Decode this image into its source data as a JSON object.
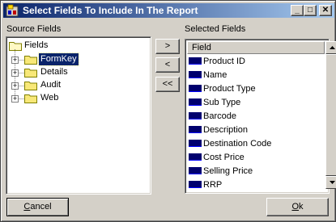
{
  "window": {
    "title": "Select Fields To Include In The Report",
    "minimize_glyph": "_",
    "maximize_glyph": "□",
    "close_glyph": "✕"
  },
  "source": {
    "label": "Source Fields",
    "root": "Fields",
    "expander_glyph": "+",
    "nodes": [
      "FormKey",
      "Details",
      "Audit",
      "Web"
    ]
  },
  "transfer": {
    "add_glyph": ">",
    "remove_glyph": "<",
    "remove_all_glyph": "<<"
  },
  "selected": {
    "label": "Selected Fields",
    "column_header": "Field",
    "items": [
      "Product ID",
      "Name",
      "Product Type",
      "Sub Type",
      "Barcode",
      "Description",
      "Destination Code",
      "Cost Price",
      "Selling Price",
      "RRP"
    ]
  },
  "buttons": {
    "cancel": {
      "hotkey": "C",
      "rest": "ancel"
    },
    "ok": {
      "hotkey": "O",
      "rest": "k"
    }
  }
}
